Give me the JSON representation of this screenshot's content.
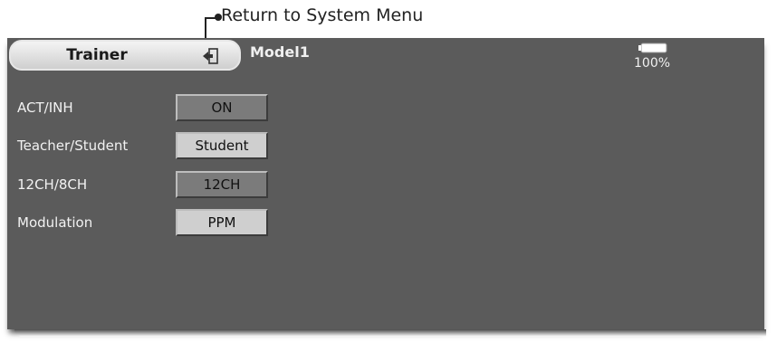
{
  "callout": {
    "text": "Return to System Menu"
  },
  "header": {
    "title": "Trainer",
    "model_name": "Model1",
    "battery_percent": "100%",
    "return_icon": "return-icon",
    "battery_icon": "battery-icon"
  },
  "rows": [
    {
      "label": "ACT/INH",
      "value": "ON"
    },
    {
      "label": "Teacher/Student",
      "value": "Student"
    },
    {
      "label": "12CH/8CH",
      "value": "12CH"
    },
    {
      "label": "Modulation",
      "value": "PPM"
    }
  ],
  "colors": {
    "screen_bg": "#5b5b5b",
    "button_dark": "#7b7b7b",
    "button_light": "#cfcfcf"
  }
}
